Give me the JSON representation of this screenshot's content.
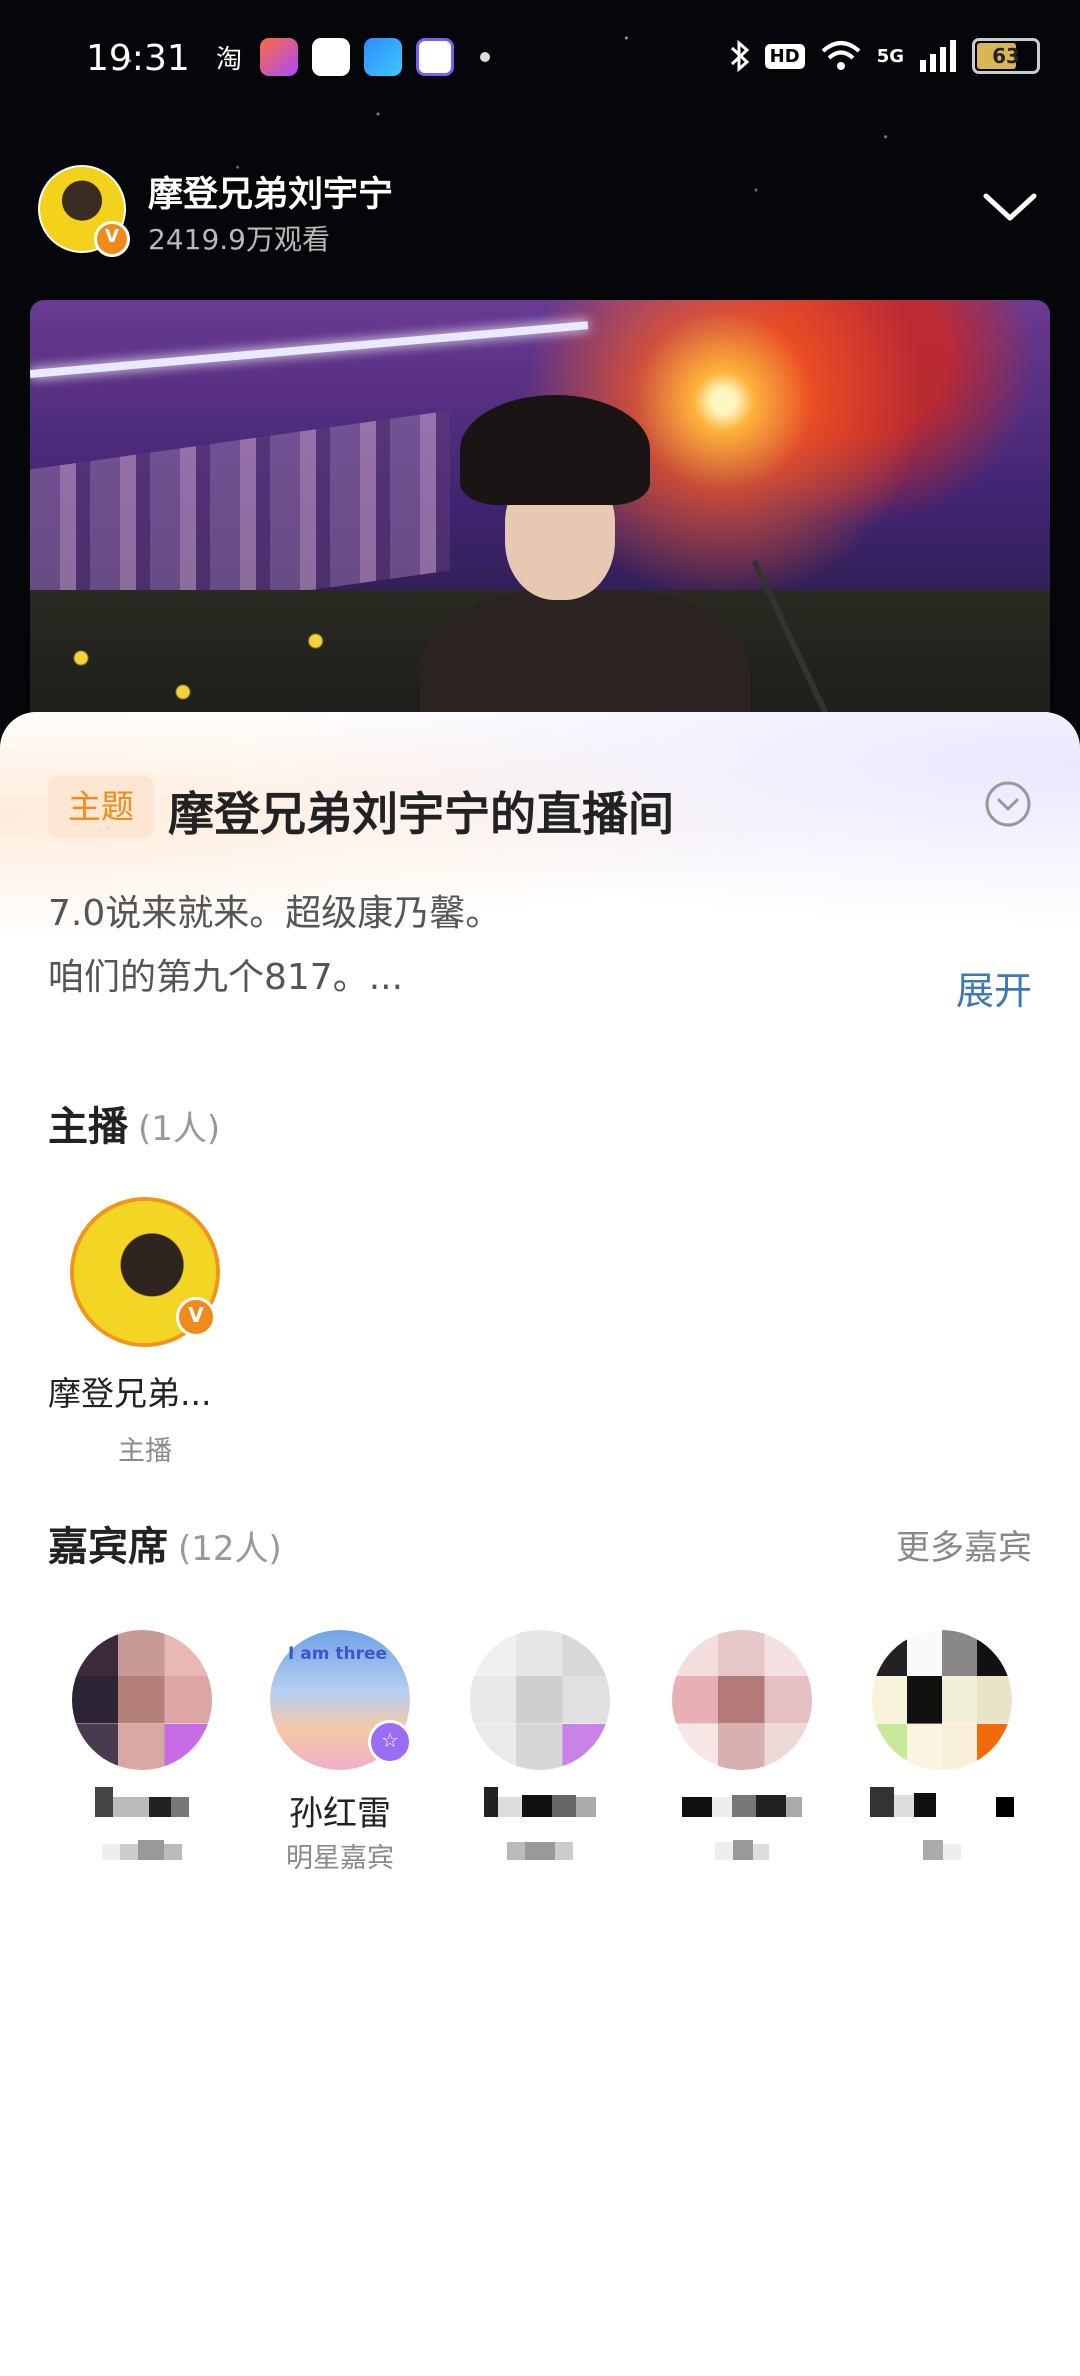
{
  "status_bar": {
    "time": "19:31",
    "taobao_label": "淘",
    "battery": "63",
    "network": "5G",
    "hd_label": "HD"
  },
  "host_header": {
    "name": "摩登兄弟刘宇宁",
    "views": "2419.9万观看",
    "verified_badge": "V"
  },
  "sheet": {
    "theme_tag": "主题",
    "title": "摩登兄弟刘宇宁的直播间",
    "description_line1": "7.0说来就来。超级康乃馨。",
    "description_line2": "咱们的第九个817。...",
    "expand_label": "展开"
  },
  "anchors": {
    "title": "主播",
    "count": "(1人)",
    "items": [
      {
        "name": "摩登兄弟...",
        "role": "主播",
        "badge": "V"
      }
    ]
  },
  "guests": {
    "title": "嘉宾席",
    "count": "(12人)",
    "more_label": "更多嘉宾",
    "items": [
      {
        "name": "",
        "role": "",
        "pixelated": true
      },
      {
        "name": "孙红雷",
        "role": "明星嘉宾",
        "pixelated": false,
        "avatar_text": "I am three",
        "badge": "☆"
      },
      {
        "name": "",
        "role": "",
        "pixelated": true
      },
      {
        "name": "",
        "role": "",
        "pixelated": true
      },
      {
        "name": "",
        "role": "",
        "pixelated": true
      }
    ]
  },
  "icons": {
    "collapse": "chevron-down-icon",
    "expand_circle": "chevron-down-circle-icon"
  },
  "colors": {
    "accent_orange": "#f08a1a",
    "link_blue": "#3f78b0",
    "guest_badge_purple": "#9b6cf5"
  }
}
